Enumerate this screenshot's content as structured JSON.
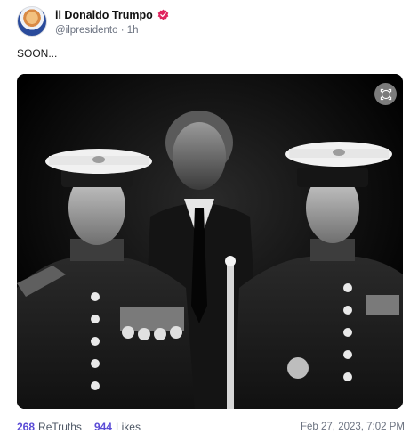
{
  "post": {
    "author": {
      "display_name": "il Donaldo Trumpo",
      "handle": "@ilpresidento",
      "time_ago": "1h",
      "verified_icon": "verified-badge-icon",
      "badge_color": "#e0245e"
    },
    "text": "SOON...",
    "media": {
      "alt_icon": "zoom-icon"
    },
    "stats": {
      "retruths_count": "268",
      "retruths_label": "ReTruths",
      "likes_count": "944",
      "likes_label": "Likes"
    },
    "timestamp": "Feb 27, 2023, 7:02 PM"
  },
  "colors": {
    "accent": "#5a4bd6",
    "muted": "#6b7280"
  }
}
